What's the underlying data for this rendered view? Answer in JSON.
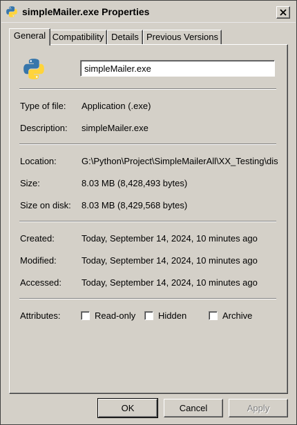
{
  "window": {
    "title": "simpleMailer.exe Properties"
  },
  "tabs": [
    "General",
    "Compatibility",
    "Details",
    "Previous Versions"
  ],
  "file": {
    "name": "simpleMailer.exe"
  },
  "fields": {
    "type_label": "Type of file:",
    "type_value": "Application (.exe)",
    "desc_label": "Description:",
    "desc_value": "simpleMailer.exe",
    "location_label": "Location:",
    "location_value": "G:\\Python\\Project\\SimpleMailerAll\\XX_Testing\\dis",
    "size_label": "Size:",
    "size_value": "8.03 MB (8,428,493 bytes)",
    "disk_label": "Size on disk:",
    "disk_value": "8.03 MB (8,429,568 bytes)",
    "created_label": "Created:",
    "created_value": "Today, September 14, 2024, 10 minutes ago",
    "modified_label": "Modified:",
    "modified_value": "Today, September 14, 2024, 10 minutes ago",
    "accessed_label": "Accessed:",
    "accessed_value": "Today, September 14, 2024, 10 minutes ago",
    "attributes_label": "Attributes:"
  },
  "attributes": [
    {
      "label": "Read-only",
      "checked": false
    },
    {
      "label": "Hidden",
      "checked": false
    },
    {
      "label": "Archive",
      "checked": false
    }
  ],
  "buttons": {
    "ok": "OK",
    "cancel": "Cancel",
    "apply": "Apply"
  },
  "icons": {
    "title": "python-icon",
    "file": "python-icon",
    "close": "close-icon"
  }
}
